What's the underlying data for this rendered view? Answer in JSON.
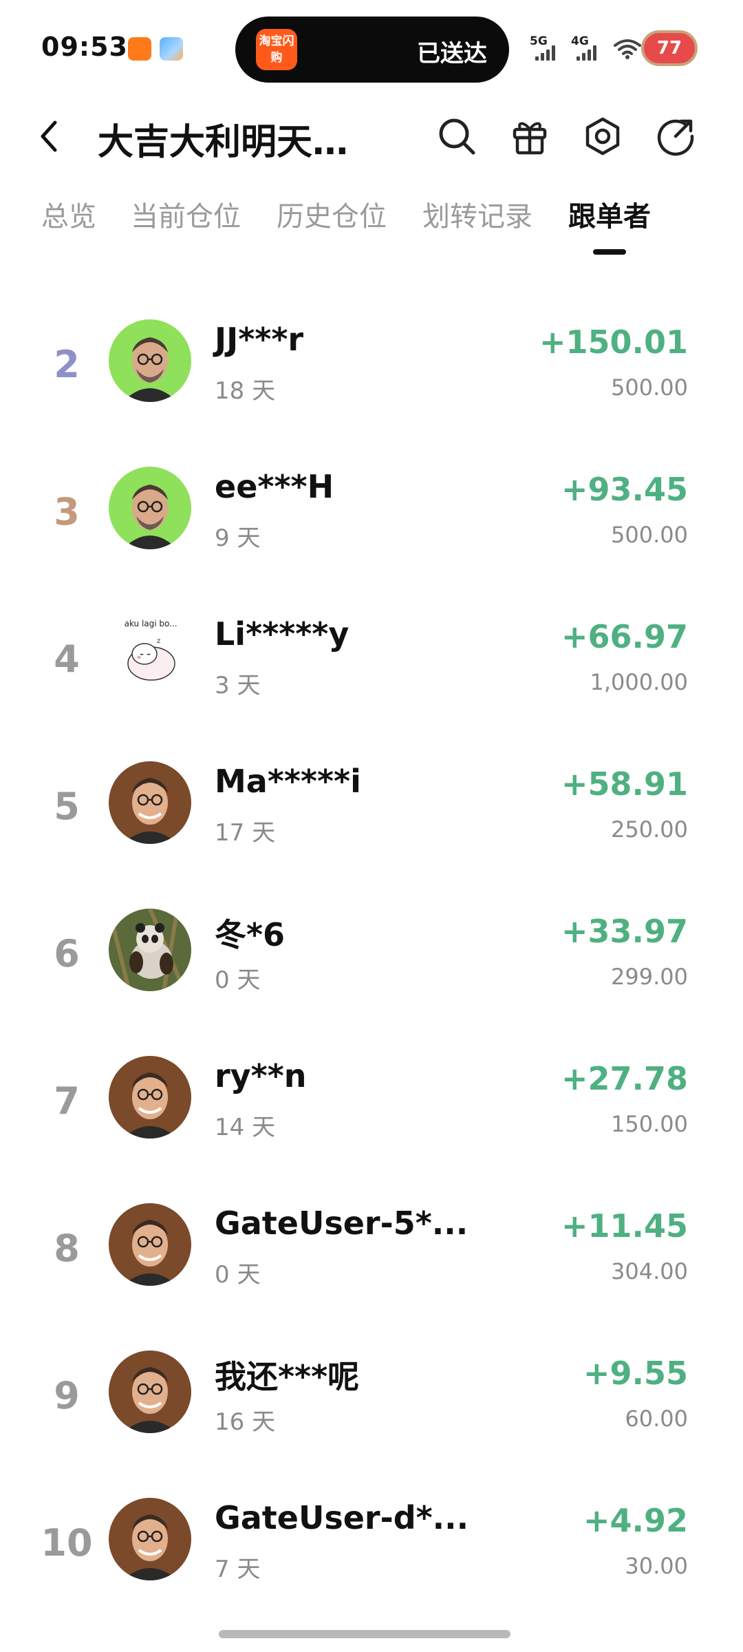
{
  "status_bar": {
    "time": "09:53",
    "notification_pill": {
      "app_icon_text": "淘宝闪购",
      "message": "已送达"
    },
    "signal_1": "5G",
    "signal_2": "4G",
    "battery": "77"
  },
  "header": {
    "title": "大吉大利明天…",
    "icons": [
      "back-icon",
      "search-icon",
      "gift-icon",
      "settings-icon",
      "share-icon"
    ]
  },
  "tabs": [
    {
      "label": "总览"
    },
    {
      "label": "当前仓位"
    },
    {
      "label": "历史仓位"
    },
    {
      "label": "划转记录"
    },
    {
      "label": "跟单者"
    }
  ],
  "active_tab": "跟单者",
  "followers": [
    {
      "rank": "2",
      "name": "JJ***r",
      "days": "18 天",
      "profit": "+150.01",
      "invest": "500.00",
      "avatar": "man-green"
    },
    {
      "rank": "3",
      "name": "ee***H",
      "days": "9 天",
      "profit": "+93.45",
      "invest": "500.00",
      "avatar": "man-green"
    },
    {
      "rank": "4",
      "name": "Li*****y",
      "days": "3 天",
      "profit": "+66.97",
      "invest": "1,000.00",
      "avatar": "sticker"
    },
    {
      "rank": "5",
      "name": "Ma*****i",
      "days": "17 天",
      "profit": "+58.91",
      "invest": "250.00",
      "avatar": "man-brown"
    },
    {
      "rank": "6",
      "name": "冬*6",
      "days": "0 天",
      "profit": "+33.97",
      "invest": "299.00",
      "avatar": "panda"
    },
    {
      "rank": "7",
      "name": "ry**n",
      "days": "14 天",
      "profit": "+27.78",
      "invest": "150.00",
      "avatar": "man-brown"
    },
    {
      "rank": "8",
      "name": "GateUser-5*...",
      "days": "0 天",
      "profit": "+11.45",
      "invest": "304.00",
      "avatar": "man-brown"
    },
    {
      "rank": "9",
      "name": "我还***呢",
      "days": "16 天",
      "profit": "+9.55",
      "invest": "60.00",
      "avatar": "man-brown"
    },
    {
      "rank": "10",
      "name": "GateUser-d*...",
      "days": "7 天",
      "profit": "+4.92",
      "invest": "30.00",
      "avatar": "man-brown"
    }
  ],
  "sticker_text": "...i aku lagi bo...",
  "colors": {
    "profit": "#4fb081",
    "rank_2": "#8f90c7",
    "rank_3": "#c49a7c",
    "rank_default": "#9a9a9a"
  }
}
